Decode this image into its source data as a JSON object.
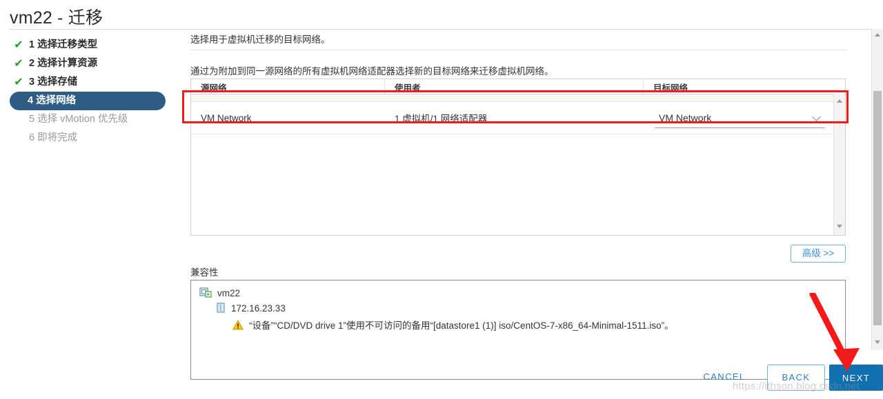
{
  "window": {
    "title": "vm22 - 迁移"
  },
  "steps": [
    {
      "num": "1",
      "label": "选择迁移类型",
      "state": "done"
    },
    {
      "num": "2",
      "label": "选择计算资源",
      "state": "done"
    },
    {
      "num": "3",
      "label": "选择存储",
      "state": "done"
    },
    {
      "num": "4",
      "label": "选择网络",
      "state": "current"
    },
    {
      "num": "5",
      "label": "选择 vMotion 优先级",
      "state": "todo"
    },
    {
      "num": "6",
      "label": "即将完成",
      "state": "todo"
    }
  ],
  "content": {
    "lead": "选择用于虚拟机迁移的目标网络。",
    "description": "通过为附加到同一源网络的所有虚拟机网络适配器选择新的目标网络来迁移虚拟机网络。",
    "table": {
      "columns": [
        "源网络",
        "使用者",
        "目标网络"
      ],
      "rows": [
        {
          "source_network": "VM Network",
          "used_by": "1 虚拟机/1 网络适配器",
          "destination_network": "VM Network"
        }
      ]
    },
    "advanced_button": "高级 >>",
    "compatibility": {
      "label": "兼容性",
      "tree": [
        {
          "level": 1,
          "icon": "vm-icon",
          "text": "vm22"
        },
        {
          "level": 2,
          "icon": "host-icon",
          "text": "172.16.23.33"
        },
        {
          "level": 3,
          "icon": "warning-icon",
          "text": "“设备”“CD/DVD drive 1”使用不可访问的备用“[datastore1 (1)] iso/CentOS-7-x86_64-Minimal-1511.iso”。"
        }
      ]
    }
  },
  "footer": {
    "cancel": "CANCEL",
    "back": "BACK",
    "next": "NEXT"
  },
  "watermark": "https://ithson.blog.csdn.net",
  "colors": {
    "accent_blue": "#1070b0",
    "link_blue": "#2b7cbf",
    "step_active_bg": "#2e5c85",
    "check_green": "#24a124",
    "annotation_red": "#f41a1a",
    "warning_yellow": "#f5c518"
  }
}
